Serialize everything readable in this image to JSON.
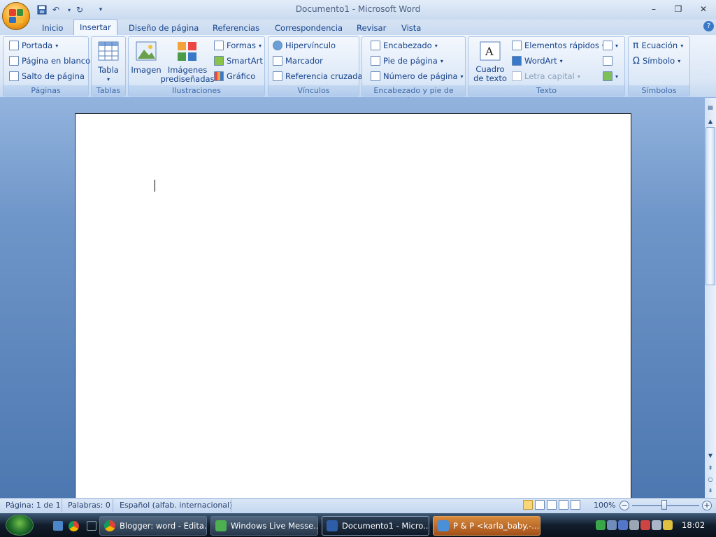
{
  "window": {
    "title": "Documento1 - Microsoft Word"
  },
  "quick_access": {
    "icons": [
      "save-icon",
      "undo-icon",
      "redo-icon",
      "customize-icon"
    ]
  },
  "window_controls": {
    "minimize": "–",
    "maximize": "❐",
    "close": "✕"
  },
  "tabs": [
    "Inicio",
    "Insertar",
    "Diseño de página",
    "Referencias",
    "Correspondencia",
    "Revisar",
    "Vista"
  ],
  "active_tab": "Insertar",
  "ribbon": {
    "paginas": {
      "label": "Páginas",
      "portada": "Portada",
      "pagina_blanco": "Página en blanco",
      "salto": "Salto de página"
    },
    "tablas": {
      "label": "Tablas",
      "tabla": "Tabla"
    },
    "ilustraciones": {
      "label": "Ilustraciones",
      "imagen": "Imagen",
      "imagenes_1": "Imágenes",
      "imagenes_2": "prediseñadas",
      "formas": "Formas",
      "smartart": "SmartArt",
      "grafico": "Gráfico"
    },
    "vinculos": {
      "label": "Vínculos",
      "hipervinculo": "Hipervínculo",
      "marcador": "Marcador",
      "referencia": "Referencia cruzada"
    },
    "encabezado": {
      "label": "Encabezado y pie de página",
      "encabezado": "Encabezado",
      "pie": "Pie de página",
      "numero": "Número de página"
    },
    "texto": {
      "label": "Texto",
      "cuadro_1": "Cuadro",
      "cuadro_2": "de texto",
      "elementos": "Elementos rápidos",
      "wordart": "WordArt",
      "letra": "Letra capital"
    },
    "simbolos": {
      "label": "Símbolos",
      "ecuacion": "Ecuación",
      "simbolo": "Símbolo"
    }
  },
  "status": {
    "pagina": "Página: 1 de 1",
    "palabras": "Palabras: 0",
    "idioma": "Español (alfab. internacional)",
    "zoom": "100%",
    "zoom_level": 1.0
  },
  "taskbar": {
    "items": [
      "Blogger: word - Edita...",
      "Windows Live Messe...",
      "Documento1 - Micro...",
      "P & P <karla_baby.-..."
    ],
    "clock": "18:02"
  },
  "colors": {
    "accent": "#15428b",
    "ribbon": "#dbe7f6",
    "workspace": "#6f96c9",
    "taskbar": "#121d2c"
  }
}
